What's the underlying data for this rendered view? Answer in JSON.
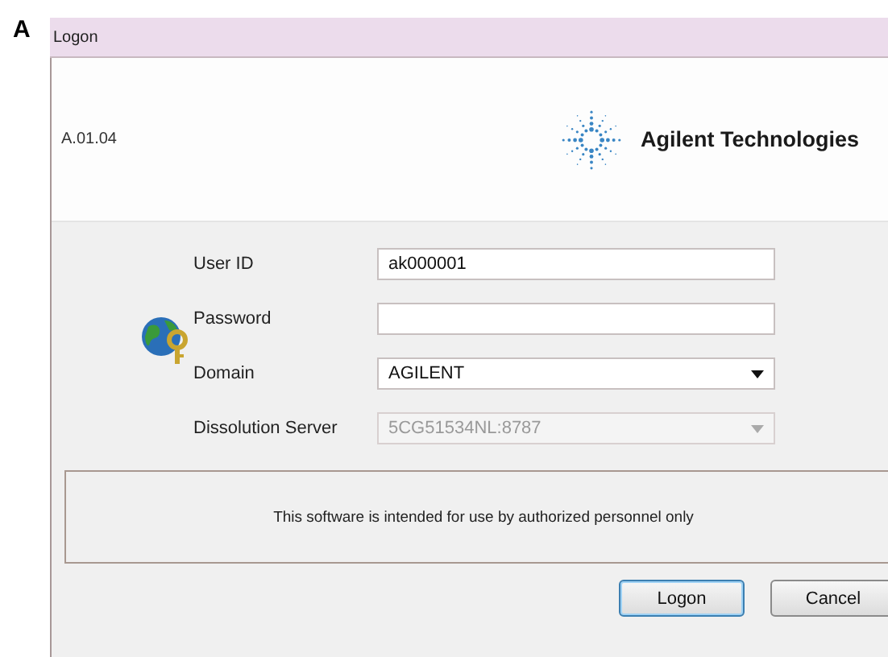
{
  "panel_label": "A",
  "window": {
    "title": "Logon"
  },
  "header": {
    "version": "A.01.04",
    "brand": "Agilent Technologies"
  },
  "fields": [
    {
      "label": "User ID",
      "kind": "text",
      "value": "ak000001",
      "disabled": false
    },
    {
      "label": "Password",
      "kind": "password",
      "disabled": false
    },
    {
      "label": "Domain",
      "kind": "dropdown",
      "value": "AGILENT",
      "disabled": false
    },
    {
      "label": "Dissolution Server",
      "kind": "dropdown",
      "value": "5CG51534NL:8787",
      "disabled": true
    }
  ],
  "notice": "This software is intended for use by authorized personnel only",
  "buttons": [
    {
      "label": "Logon",
      "default": true
    },
    {
      "label": "Cancel",
      "default": false
    }
  ]
}
